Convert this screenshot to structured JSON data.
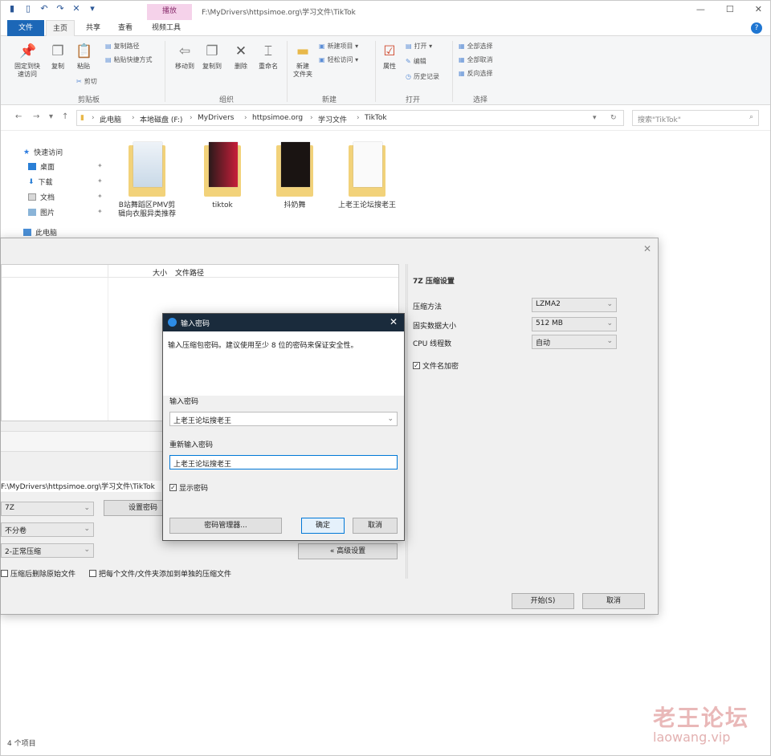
{
  "titlebar": {
    "context_tab": "播放",
    "path_title": "F:\\MyDrivers\\httpsimoe.org\\学习文件\\TikTok",
    "buttons": [
      "—",
      "☐",
      "✕"
    ]
  },
  "tabs": {
    "file": "文件",
    "home": "主页",
    "share": "共享",
    "view": "查看",
    "video_tools": "视频工具"
  },
  "ribbon": {
    "clipboard": {
      "label": "剪贴板",
      "pin": "固定到快\n速访问",
      "copy": "复制",
      "paste": "粘贴",
      "copy_path": "复制路径",
      "paste_shortcut": "粘贴快捷方式",
      "cut": "剪切"
    },
    "organize": {
      "label": "组织",
      "move_to": "移动到",
      "copy_to": "复制到",
      "delete": "删除",
      "rename": "重命名"
    },
    "new": {
      "label": "新建",
      "new_folder": "新建\n文件夹",
      "new_item": "新建项目 ▾",
      "easy_access": "轻松访问 ▾"
    },
    "open": {
      "label": "打开",
      "properties": "属性",
      "open": "打开 ▾",
      "edit": "编辑",
      "history": "历史记录"
    },
    "select": {
      "label": "选择",
      "select_all": "全部选择",
      "select_none": "全部取消",
      "invert": "反向选择"
    }
  },
  "address": {
    "crumbs": [
      "此电脑",
      "本地磁盘 (F:)",
      "MyDrivers",
      "httpsimoe.org",
      "学习文件",
      "TikTok"
    ],
    "search_placeholder": "搜索\"TikTok\""
  },
  "nav": {
    "quick_access": "快速访问",
    "items": [
      "桌面",
      "下载",
      "文档",
      "图片"
    ],
    "this_pc": "此电脑"
  },
  "folders": [
    {
      "name": "B站舞蹈区PMV剪辑向衣服异类推荐"
    },
    {
      "name": "tiktok"
    },
    {
      "name": "抖奶舞"
    },
    {
      "name": "上老王论坛搜老王"
    }
  ],
  "status": {
    "count": "4 个项目"
  },
  "watermark": {
    "cn": "老王论坛",
    "en": "laowang.vip"
  },
  "archive_dialog": {
    "list_headers": [
      "大小",
      "文件路径"
    ],
    "path": "F:\\MyDrivers\\httpsimoe.org\\学习文件\\TikTok",
    "format": "7Z",
    "split": "不分卷",
    "level": "2-正常压缩",
    "set_password": "设置密码",
    "advanced": "« 高级设置",
    "delete_after": "压缩后删除原始文件",
    "each_to_separate": "把每个文件/文件夹添加到单独的压缩文件",
    "start": "开始(S)",
    "cancel": "取消",
    "settings": {
      "title": "7Z 压缩设置",
      "method_label": "压缩方法",
      "method": "LZMA2",
      "dict_label": "固实数据大小",
      "dict": "512 MB",
      "threads_label": "CPU 线程数",
      "threads": "自动",
      "encrypt_names": "文件名加密"
    }
  },
  "password_dialog": {
    "title": "输入密码",
    "hint": "输入压缩包密码。建议使用至少 8 位的密码来保证安全性。",
    "enter_label": "输入密码",
    "password": "上老王论坛搜老王",
    "reenter_label": "重新输入密码",
    "password2": "上老王论坛搜老王",
    "show_password": "显示密码",
    "manager": "密码管理器...",
    "ok": "确定",
    "cancel": "取消"
  }
}
